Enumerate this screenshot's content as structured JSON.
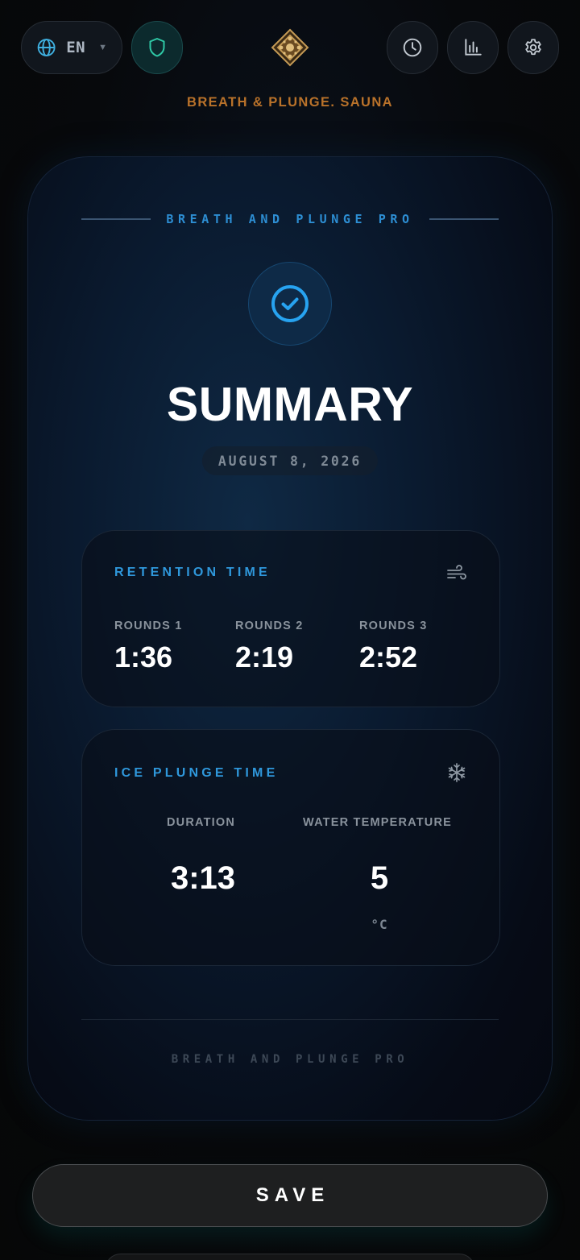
{
  "header": {
    "language_code": "EN",
    "brand": "BREATH & PLUNGE. SAUNA"
  },
  "icons": {
    "globe": "globe-icon",
    "shield": "shield-icon",
    "logo": "ornament-logo",
    "history": "clock-icon",
    "stats": "bar-chart-icon",
    "settings": "gear-icon",
    "check": "check-circle-icon",
    "wind": "wind-icon",
    "snowflake": "snowflake-icon"
  },
  "colors": {
    "accent": "#2f98dc",
    "brand": "#b9722a",
    "shield": "#2fc9a6"
  },
  "card": {
    "header_label": "BREATH AND PLUNGE PRO",
    "title": "SUMMARY",
    "date": "AUGUST 8, 2026",
    "footer_label": "BREATH AND PLUNGE PRO"
  },
  "retention": {
    "title": "RETENTION TIME",
    "rounds": [
      {
        "label": "ROUNDS 1",
        "value": "1:36"
      },
      {
        "label": "ROUNDS 2",
        "value": "2:19"
      },
      {
        "label": "ROUNDS 3",
        "value": "2:52"
      }
    ]
  },
  "plunge": {
    "title": "ICE PLUNGE TIME",
    "duration_label": "DURATION",
    "duration_value": "3:13",
    "temp_label": "WATER TEMPERATURE",
    "temp_value": "5",
    "temp_unit": "°C"
  },
  "actions": {
    "save_label": "SAVE"
  }
}
